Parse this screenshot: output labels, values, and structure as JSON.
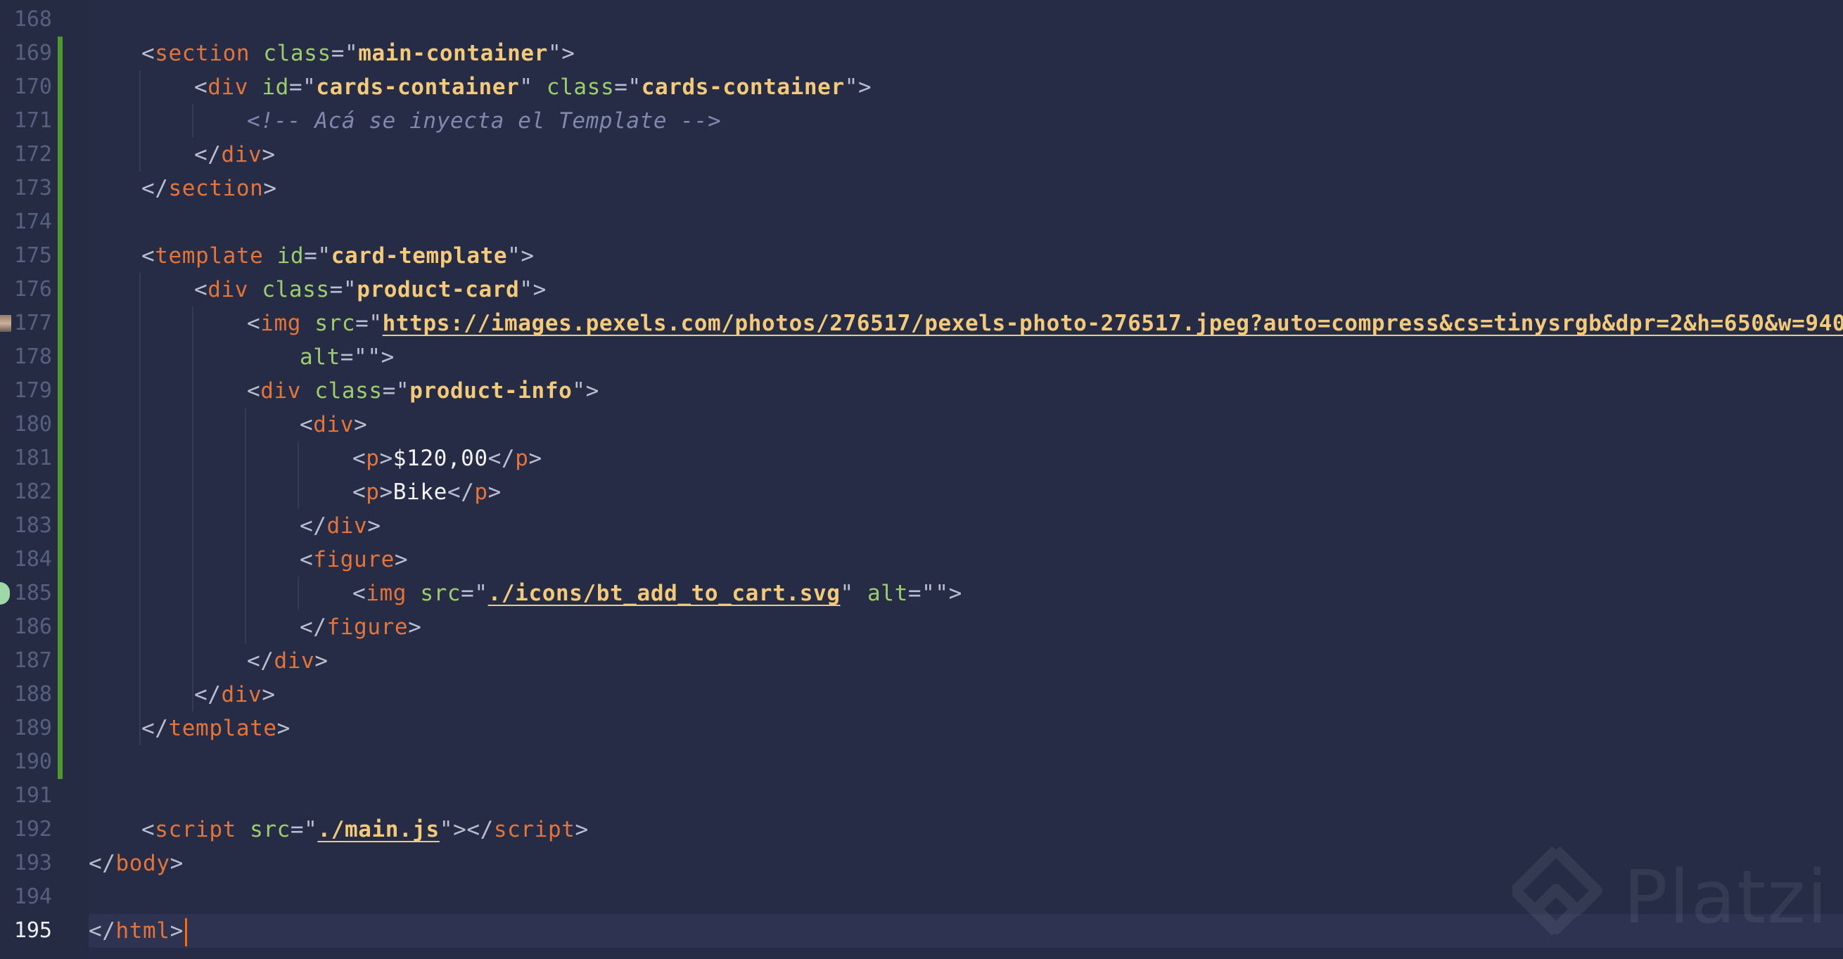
{
  "editor": {
    "language": "html",
    "current_line": 195,
    "watermark": "Platzi",
    "colors": {
      "background": "#262c45",
      "tag": "#e5743a",
      "attribute": "#9ecd6d",
      "string": "#f3c97a",
      "comment": "#7f89ad",
      "punctuation": "#b9bed0",
      "modified_bar": "#4e9a2e",
      "cursor": "#ff6a00"
    },
    "lines": [
      {
        "n": "168",
        "tokens": []
      },
      {
        "n": "169",
        "tokens": [
          {
            "k": "p",
            "v": "<"
          },
          {
            "k": "t",
            "v": "section"
          },
          {
            "k": "p",
            "v": " "
          },
          {
            "k": "a",
            "v": "class"
          },
          {
            "k": "p",
            "v": "=\""
          },
          {
            "k": "s",
            "v": "main-container"
          },
          {
            "k": "p",
            "v": "\">"
          }
        ]
      },
      {
        "n": "170",
        "tokens": [
          {
            "k": "p",
            "v": "<"
          },
          {
            "k": "t",
            "v": "div"
          },
          {
            "k": "p",
            "v": " "
          },
          {
            "k": "a",
            "v": "id"
          },
          {
            "k": "p",
            "v": "=\""
          },
          {
            "k": "s",
            "v": "cards-container"
          },
          {
            "k": "p",
            "v": "\" "
          },
          {
            "k": "a",
            "v": "class"
          },
          {
            "k": "p",
            "v": "=\""
          },
          {
            "k": "s",
            "v": "cards-container"
          },
          {
            "k": "p",
            "v": "\">"
          }
        ]
      },
      {
        "n": "171",
        "tokens": [
          {
            "k": "c",
            "v": "<!-- Acá se inyecta el Template -->"
          }
        ]
      },
      {
        "n": "172",
        "tokens": [
          {
            "k": "p",
            "v": "</"
          },
          {
            "k": "t",
            "v": "div"
          },
          {
            "k": "p",
            "v": ">"
          }
        ]
      },
      {
        "n": "173",
        "tokens": [
          {
            "k": "p",
            "v": "</"
          },
          {
            "k": "t",
            "v": "section"
          },
          {
            "k": "p",
            "v": ">"
          }
        ]
      },
      {
        "n": "174",
        "tokens": []
      },
      {
        "n": "175",
        "tokens": [
          {
            "k": "p",
            "v": "<"
          },
          {
            "k": "t",
            "v": "template"
          },
          {
            "k": "p",
            "v": " "
          },
          {
            "k": "a",
            "v": "id"
          },
          {
            "k": "p",
            "v": "=\""
          },
          {
            "k": "s",
            "v": "card-template"
          },
          {
            "k": "p",
            "v": "\">"
          }
        ]
      },
      {
        "n": "176",
        "tokens": [
          {
            "k": "p",
            "v": "<"
          },
          {
            "k": "t",
            "v": "div"
          },
          {
            "k": "p",
            "v": " "
          },
          {
            "k": "a",
            "v": "class"
          },
          {
            "k": "p",
            "v": "=\""
          },
          {
            "k": "s",
            "v": "product-card"
          },
          {
            "k": "p",
            "v": "\">"
          }
        ]
      },
      {
        "n": "177",
        "tokens": [
          {
            "k": "p",
            "v": "<"
          },
          {
            "k": "t",
            "v": "img"
          },
          {
            "k": "p",
            "v": " "
          },
          {
            "k": "a",
            "v": "src"
          },
          {
            "k": "p",
            "v": "=\""
          },
          {
            "k": "u",
            "v": "https://images.pexels.com/photos/276517/pexels-photo-276517.jpeg?auto=compress&cs=tinysrgb&dpr=2&h=650&w=940"
          },
          {
            "k": "p",
            "v": "\""
          }
        ]
      },
      {
        "n": "178",
        "tokens": [
          {
            "k": "a",
            "v": "alt"
          },
          {
            "k": "p",
            "v": "=\"\">"
          }
        ]
      },
      {
        "n": "179",
        "tokens": [
          {
            "k": "p",
            "v": "<"
          },
          {
            "k": "t",
            "v": "div"
          },
          {
            "k": "p",
            "v": " "
          },
          {
            "k": "a",
            "v": "class"
          },
          {
            "k": "p",
            "v": "=\""
          },
          {
            "k": "s",
            "v": "product-info"
          },
          {
            "k": "p",
            "v": "\">"
          }
        ]
      },
      {
        "n": "180",
        "tokens": [
          {
            "k": "p",
            "v": "<"
          },
          {
            "k": "t",
            "v": "div"
          },
          {
            "k": "p",
            "v": ">"
          }
        ]
      },
      {
        "n": "181",
        "tokens": [
          {
            "k": "p",
            "v": "<"
          },
          {
            "k": "t",
            "v": "p"
          },
          {
            "k": "p",
            "v": ">"
          },
          {
            "k": "x",
            "v": "$120,00"
          },
          {
            "k": "p",
            "v": "</"
          },
          {
            "k": "t",
            "v": "p"
          },
          {
            "k": "p",
            "v": ">"
          }
        ]
      },
      {
        "n": "182",
        "tokens": [
          {
            "k": "p",
            "v": "<"
          },
          {
            "k": "t",
            "v": "p"
          },
          {
            "k": "p",
            "v": ">"
          },
          {
            "k": "x",
            "v": "Bike"
          },
          {
            "k": "p",
            "v": "</"
          },
          {
            "k": "t",
            "v": "p"
          },
          {
            "k": "p",
            "v": ">"
          }
        ]
      },
      {
        "n": "183",
        "tokens": [
          {
            "k": "p",
            "v": "</"
          },
          {
            "k": "t",
            "v": "div"
          },
          {
            "k": "p",
            "v": ">"
          }
        ]
      },
      {
        "n": "184",
        "tokens": [
          {
            "k": "p",
            "v": "<"
          },
          {
            "k": "t",
            "v": "figure"
          },
          {
            "k": "p",
            "v": ">"
          }
        ]
      },
      {
        "n": "185",
        "tokens": [
          {
            "k": "p",
            "v": "<"
          },
          {
            "k": "t",
            "v": "img"
          },
          {
            "k": "p",
            "v": " "
          },
          {
            "k": "a",
            "v": "src"
          },
          {
            "k": "p",
            "v": "=\""
          },
          {
            "k": "u",
            "v": "./icons/bt_add_to_cart.svg"
          },
          {
            "k": "p",
            "v": "\" "
          },
          {
            "k": "a",
            "v": "alt"
          },
          {
            "k": "p",
            "v": "=\"\">"
          }
        ]
      },
      {
        "n": "186",
        "tokens": [
          {
            "k": "p",
            "v": "</"
          },
          {
            "k": "t",
            "v": "figure"
          },
          {
            "k": "p",
            "v": ">"
          }
        ]
      },
      {
        "n": "187",
        "tokens": [
          {
            "k": "p",
            "v": "</"
          },
          {
            "k": "t",
            "v": "div"
          },
          {
            "k": "p",
            "v": ">"
          }
        ]
      },
      {
        "n": "188",
        "tokens": [
          {
            "k": "p",
            "v": "</"
          },
          {
            "k": "t",
            "v": "div"
          },
          {
            "k": "p",
            "v": ">"
          }
        ]
      },
      {
        "n": "189",
        "tokens": [
          {
            "k": "p",
            "v": "</"
          },
          {
            "k": "t",
            "v": "template"
          },
          {
            "k": "p",
            "v": ">"
          }
        ]
      },
      {
        "n": "190",
        "tokens": []
      },
      {
        "n": "191",
        "tokens": []
      },
      {
        "n": "192",
        "tokens": [
          {
            "k": "p",
            "v": "<"
          },
          {
            "k": "t",
            "v": "script"
          },
          {
            "k": "p",
            "v": " "
          },
          {
            "k": "a",
            "v": "src"
          },
          {
            "k": "p",
            "v": "=\""
          },
          {
            "k": "u",
            "v": "./main.js"
          },
          {
            "k": "p",
            "v": "\"></"
          },
          {
            "k": "t",
            "v": "script"
          },
          {
            "k": "p",
            "v": ">"
          }
        ]
      },
      {
        "n": "193",
        "tokens": [
          {
            "k": "p",
            "v": "</"
          },
          {
            "k": "t",
            "v": "body"
          },
          {
            "k": "p",
            "v": ">"
          }
        ]
      },
      {
        "n": "194",
        "tokens": []
      },
      {
        "n": "195",
        "tokens": [
          {
            "k": "p",
            "v": "</"
          },
          {
            "k": "t",
            "v": "html"
          },
          {
            "k": "p",
            "v": ">"
          }
        ]
      }
    ]
  }
}
